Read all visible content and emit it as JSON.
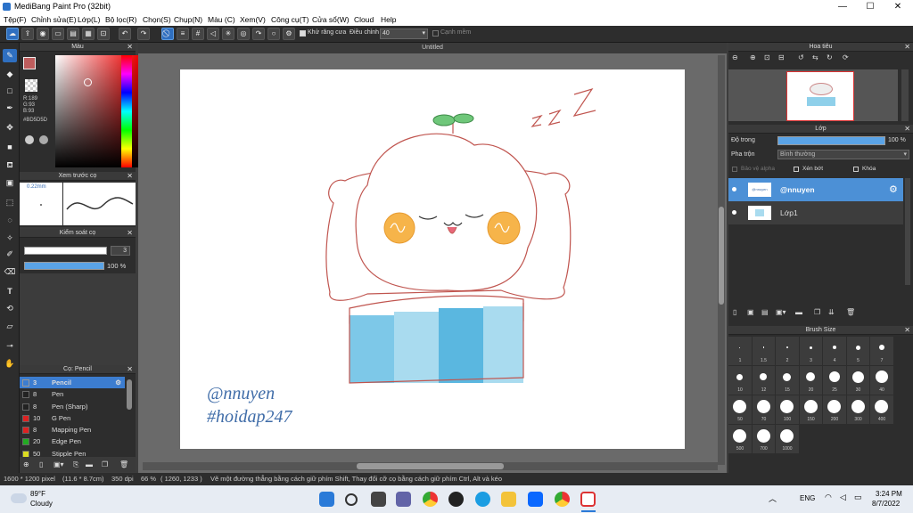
{
  "window": {
    "title": "MediBang Paint Pro (32bit)",
    "min": "—",
    "max": "☐",
    "close": "✕"
  },
  "menu": [
    "Tệp(F)",
    "Chỉnh sửa(E)",
    "Lớp(L)",
    "Bộ lọc(R)",
    "Chọn(S)",
    "Chụp(N)",
    "Màu (C)",
    "Xem(V)",
    "Công cụ(T)",
    "Cửa sổ(W)",
    "Cloud",
    "Help"
  ],
  "toolbar": {
    "antialias_label": "Khử răng cưa",
    "correction_label": "Điều chỉnh",
    "correction_value": "40",
    "soft_edge_label": "Cạnh mềm"
  },
  "canvas": {
    "tab_title": "Untitled"
  },
  "color_panel": {
    "title": "Màu",
    "r": "R:189",
    "g": "G:93",
    "b": "B:93",
    "hex": "#BD5D5D",
    "primary_color": "#bd5d5d"
  },
  "brush_preview": {
    "title": "Xem trước cọ",
    "size": "0.22mm"
  },
  "brush_control": {
    "title": "Kiểm soát cọ",
    "size_value": "3",
    "opacity_value": "100 %"
  },
  "brush_list": {
    "title": "Cọ: Pencil",
    "items": [
      {
        "size": "3",
        "name": "Pencil",
        "color": "#222222",
        "selected": true
      },
      {
        "size": "8",
        "name": "Pen",
        "color": "#222222"
      },
      {
        "size": "8",
        "name": "Pen (Sharp)",
        "color": "#222222"
      },
      {
        "size": "10",
        "name": "G Pen",
        "color": "#d22"
      },
      {
        "size": "8",
        "name": "Mapping Pen",
        "color": "#d22"
      },
      {
        "size": "20",
        "name": "Edge Pen",
        "color": "#2a2"
      },
      {
        "size": "50",
        "name": "Stipple Pen",
        "color": "#dd2"
      }
    ]
  },
  "navigator": {
    "title": "Hoa tiêu"
  },
  "layers": {
    "title": "Lớp",
    "opacity_label": "Độ trong",
    "opacity_value": "100 %",
    "opacity_fraction": 1.0,
    "blend_label": "Pha trộn",
    "blend_value": "Bình thường",
    "protect_alpha": "Bảo vệ alpha",
    "clipping": "Xén bớt",
    "lock": "Khóa",
    "items": [
      {
        "name": "@nnuyen",
        "selected": true
      },
      {
        "name": "Lớp1",
        "selected": false
      }
    ]
  },
  "brush_size": {
    "title": "Brush Size",
    "sizes": [
      "1",
      "1.5",
      "2",
      "3",
      "4",
      "5",
      "7",
      "10",
      "12",
      "15",
      "20",
      "25",
      "30",
      "40",
      "50",
      "70",
      "100",
      "150",
      "200",
      "300",
      "400",
      "500",
      "700",
      "1000"
    ]
  },
  "artwork": {
    "watermark1": "@nnuyen",
    "watermark2": "#hoidap247",
    "zzz": "z z Z"
  },
  "status": {
    "dimensions": "1600 * 1200 pixel",
    "physical": "(11.6 * 8.7cm)",
    "dpi": "350 dpi",
    "zoom": "66 %",
    "coords": "( 1260, 1233 )",
    "hint": "Vẽ một đường thẳng bằng cách giữ phím Shift, Thay đổi cỡ cọ bằng cách giữ phím Ctrl, Alt và kéo"
  },
  "taskbar": {
    "weather_temp": "89°F",
    "weather_desc": "Cloudy",
    "lang": "ENG",
    "time": "3:24 PM",
    "date": "8/7/2022"
  }
}
